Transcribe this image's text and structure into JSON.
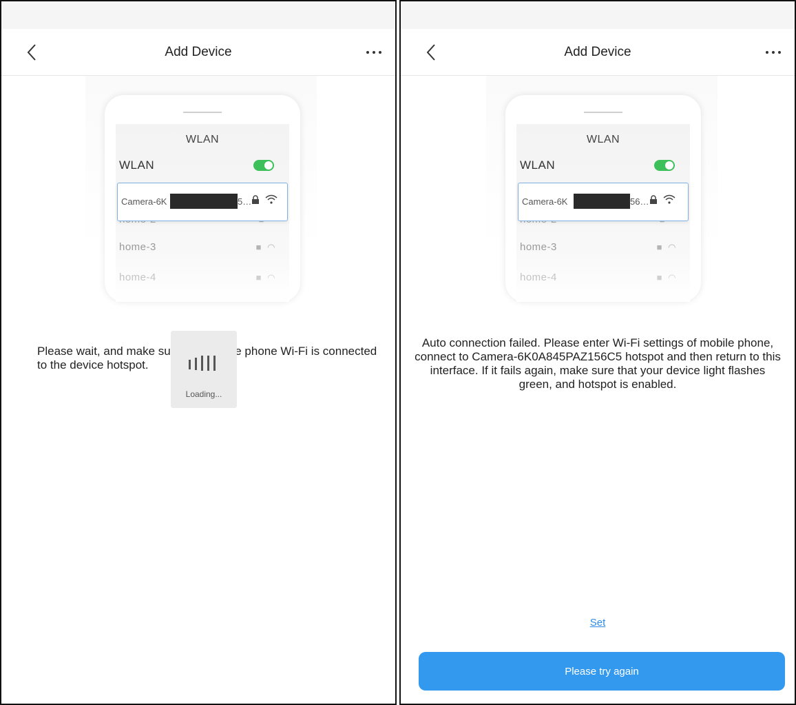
{
  "colors": {
    "accent_blue": "#3399ef",
    "link_blue": "#2e8ce6",
    "toggle_green": "#3dbf5a",
    "card_border": "#7fb0e3"
  },
  "screens": [
    {
      "header": {
        "title": "Add Device",
        "back_icon": "chevron-left-icon",
        "more_icon": "more-dots-icon"
      },
      "illustration": {
        "heading": "WLAN",
        "wlan_label": "WLAN",
        "wlan_toggle_on": true,
        "camera_prefix": "Camera-6K",
        "camera_suffix": "5…",
        "networks": [
          "home-2",
          "home-3",
          "home-4"
        ]
      },
      "message": "Please wait, and make sure that mobile phone Wi-Fi is connected to the device hotspot.",
      "loading": {
        "label": "Loading..."
      }
    },
    {
      "header": {
        "title": "Add Device",
        "back_icon": "chevron-left-icon",
        "more_icon": "more-dots-icon"
      },
      "illustration": {
        "heading": "WLAN",
        "wlan_label": "WLAN",
        "wlan_toggle_on": true,
        "camera_prefix": "Camera-6K",
        "camera_suffix": "56…",
        "networks": [
          "home-2",
          "home-3",
          "home-4"
        ]
      },
      "message": "Auto connection failed. Please enter Wi-Fi settings of mobile phone, connect to Camera-6K0A845PAZ156C5 hotspot and then return to this interface. If it fails again, make sure that your device light flashes green, and hotspot is enabled.",
      "set_link": "Set",
      "retry_button": "Please try again"
    }
  ]
}
